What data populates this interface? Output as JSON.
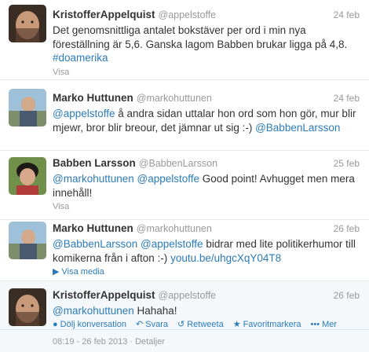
{
  "tweets": [
    {
      "fullname": "KristofferAppelquist",
      "username": "@appelstoffe",
      "time": "24 feb",
      "text_parts": [
        "Det genomsnittliga antalet bokstäver per ord i min nya föreställning är 5,6. Ganska lagom Babben brukar ligga på 4,8. ",
        "#doamerika"
      ],
      "meta": "Visa"
    },
    {
      "fullname": "Marko Huttunen",
      "username": "@markohuttunen",
      "time": "24 feb",
      "text_parts": [
        "@appelstoffe",
        " å andra sidan uttalar hon ord som hon gör, mur blir mjewr, bror blir breour, det jämnar ut sig :-) ",
        "@BabbenLarsson"
      ],
      "meta": ""
    },
    {
      "fullname": "Babben Larsson",
      "username": "@BabbenLarsson",
      "time": "25 feb",
      "text_parts": [
        "@markohuttunen",
        " ",
        "@appelstoffe",
        " Good point! Avhugget men mera innehåll!"
      ],
      "meta": "Visa"
    },
    {
      "fullname": "Marko Huttunen",
      "username": "@markohuttunen",
      "time": "26 feb",
      "text_parts": [
        "@BabbenLarsson",
        " ",
        "@appelstoffe",
        " bidrar med lite politikerhumor till komikerna från i afton :-) ",
        "youtu.be/uhgcXqY04T8"
      ],
      "meta": "Visa media"
    },
    {
      "fullname": "KristofferAppelquist",
      "username": "@appelstoffe",
      "time": "26 feb",
      "text_parts": [
        "@markohuttunen",
        " Hahaha!"
      ],
      "actions": {
        "collapse": "Dölj konversation",
        "reply": "Svara",
        "retweet": "Retweeta",
        "favorite": "Favoritmarkera",
        "more": "Mer"
      }
    }
  ],
  "footer": {
    "timestamp": "08:19 - 26 feb 2013",
    "separator": "·",
    "details": "Detaljer"
  },
  "colors": {
    "link": "#2b7bb9",
    "muted": "#999999",
    "text": "#333333"
  },
  "icons": {
    "collapse": "conversation-icon",
    "reply": "reply-icon",
    "retweet": "retweet-icon",
    "favorite": "star-icon",
    "more": "more-dots-icon"
  }
}
